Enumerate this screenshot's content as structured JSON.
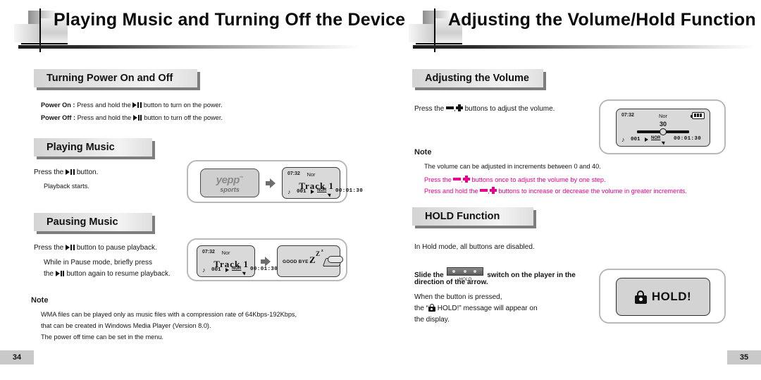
{
  "left_page": {
    "header_title": "Playing Music and Turning Off the Device",
    "page_number": "34",
    "sections": {
      "power": {
        "heading": "Turning Power On and Off",
        "power_on_label": "Power On :",
        "power_on_text_a": "Press and hold the",
        "power_on_text_b": "button to turn on the power.",
        "power_off_label": "Power Off :",
        "power_off_text_a": "Press and hold the",
        "power_off_text_b": "button to turn off the power."
      },
      "playing": {
        "heading": "Playing Music",
        "line1_a": "Press the",
        "line1_b": "button.",
        "line2": "Playback starts."
      },
      "pausing": {
        "heading": "Pausing Music",
        "line1_a": "Press the",
        "line1_b": "button to pause playback.",
        "line2": "While in Pause mode, briefly press",
        "line3_a": "the",
        "line3_b": "button again to resume playback."
      }
    },
    "note": {
      "title": "Note",
      "lines": [
        "WMA files can be played only as music files with a compression rate of 64Kbps-192Kbps,",
        "that can be created in Windows Media Player (Version 8.0).",
        "The power off time can be set in the menu."
      ]
    },
    "illustration_play": {
      "logo_text": "yepp",
      "logo_tm": "™",
      "logo_sub": "sports",
      "lcd": {
        "time": "07:32",
        "mode": "Nor",
        "track": "Track 1",
        "track_num": "001",
        "repeat": "NOR",
        "elapsed": "00:01:30"
      }
    },
    "illustration_pause": {
      "lcd": {
        "time": "07:32",
        "mode": "Nor",
        "track": "Track 1",
        "track_num": "001",
        "repeat": "NOR",
        "elapsed": "00:01:30"
      },
      "goodbye": {
        "text": "GOOD BYE ~",
        "z_large": "Z",
        "z_mid": "Z",
        "z_small": "z"
      }
    }
  },
  "right_page": {
    "header_title": "Adjusting the Volume/Hold Function",
    "page_number": "35",
    "sections": {
      "volume": {
        "heading": "Adjusting the Volume",
        "line_a": "Press the",
        "line_sep": ",",
        "line_b": "buttons  to adjust the volume."
      },
      "hold": {
        "heading": "HOLD Function",
        "line1": "In Hold mode, all buttons are disabled.",
        "slide_a": "Slide the",
        "slide_switch_label": "HOLD",
        "slide_b": "switch on the player in the",
        "slide_c": "direction of the arrow.",
        "msg1": "When the button is pressed,",
        "msg2_a": "the “",
        "msg2_b": "HOLD!” message will appear on",
        "msg3": "the display."
      }
    },
    "note": {
      "title": "Note",
      "line1": "The volume can be adjusted in increments between 0 and 40.",
      "line2_a": "Press the",
      "line2_sep": ",",
      "line2_b": "buttons once to adjust the volume by one step.",
      "line3_a": "Press and hold the",
      "line3_sep": ",",
      "line3_b": "buttons to increase or decrease the volume in greater increments.",
      "color": "#e8008c"
    },
    "illustration_volume": {
      "lcd": {
        "time": "07:32",
        "mode": "Nor",
        "volume_value": "30",
        "track_num": "001",
        "repeat": "NOR",
        "elapsed": "00:01:30"
      }
    },
    "illustration_hold": {
      "label": "HOLD!"
    }
  }
}
